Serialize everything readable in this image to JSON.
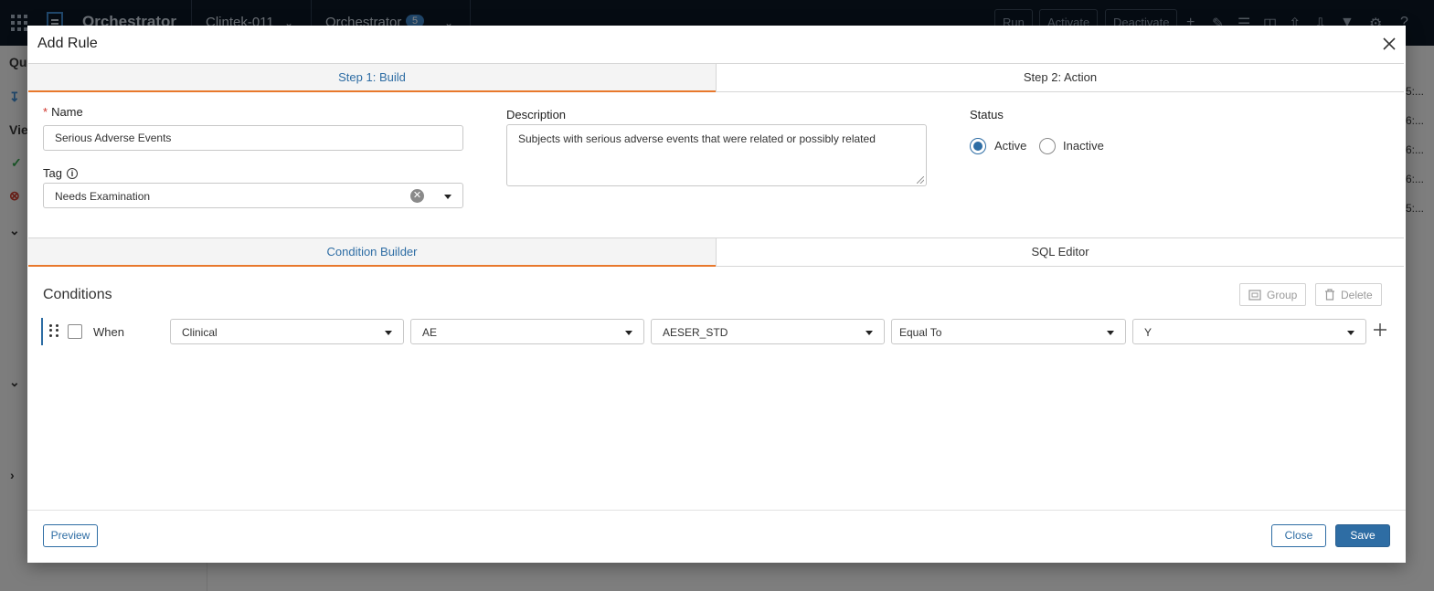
{
  "background": {
    "topbar": {
      "app_name": "Orchestrator",
      "study": "Clintek-011",
      "module": "Orchestrator",
      "module_badge": "5",
      "buttons": [
        "Run",
        "Activate",
        "Deactivate"
      ]
    },
    "left_panel": {
      "labels": [
        "Qui",
        "Vie"
      ]
    },
    "right_panel": {
      "cells": [
        "5:...",
        "6:...",
        "6:...",
        "6:...",
        "5:..."
      ]
    }
  },
  "modal": {
    "title": "Add Rule",
    "close_icon": "close-icon",
    "steps": [
      {
        "label": "Step 1: Build",
        "active": true
      },
      {
        "label": "Step 2: Action",
        "active": false
      }
    ],
    "form": {
      "name": {
        "label": "Name",
        "required_mark": "*",
        "value": "Serious Adverse Events"
      },
      "tag": {
        "label": "Tag",
        "value": "Needs Examination"
      },
      "description": {
        "label": "Description",
        "value": "Subjects with serious adverse events that were related or possibly related"
      },
      "status": {
        "label": "Status",
        "options": [
          {
            "label": "Active",
            "checked": true
          },
          {
            "label": "Inactive",
            "checked": false
          }
        ]
      }
    },
    "builder_tabs": [
      {
        "label": "Condition Builder",
        "active": true
      },
      {
        "label": "SQL Editor",
        "active": false
      }
    ],
    "conditions": {
      "title": "Conditions",
      "group_label": "Group",
      "delete_label": "Delete",
      "rows": [
        {
          "when_label": "When",
          "source": "Clinical",
          "domain": "AE",
          "variable": "AESER_STD",
          "operator": "Equal To",
          "value": "Y"
        }
      ]
    },
    "footer": {
      "preview_label": "Preview",
      "close_label": "Close",
      "save_label": "Save"
    },
    "colors": {
      "accent": "#2e6da4",
      "active_tab_underline": "#e8782c",
      "required": "#d0342c"
    }
  }
}
